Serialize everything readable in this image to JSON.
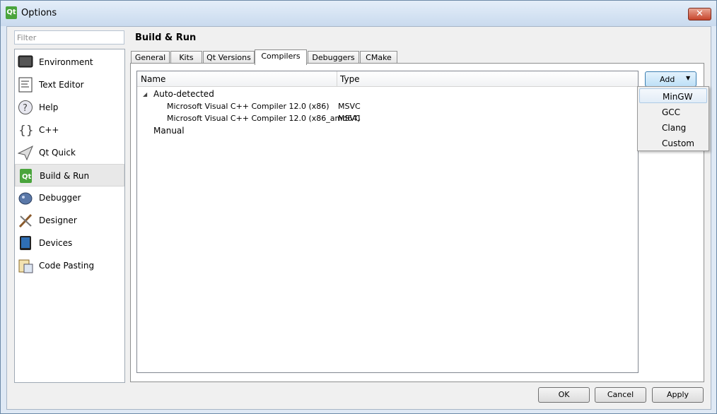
{
  "window": {
    "title": "Options",
    "app_icon": "qt-icon",
    "close_label": "✕"
  },
  "filter": {
    "placeholder": "Filter"
  },
  "sidebar": {
    "items": [
      {
        "label": "Environment",
        "icon": "monitor-icon"
      },
      {
        "label": "Text Editor",
        "icon": "text-editor-icon"
      },
      {
        "label": "Help",
        "icon": "help-icon"
      },
      {
        "label": "C++",
        "icon": "cpp-icon"
      },
      {
        "label": "Qt Quick",
        "icon": "qt-quick-icon"
      },
      {
        "label": "Build & Run",
        "icon": "build-run-icon",
        "selected": true
      },
      {
        "label": "Debugger",
        "icon": "debugger-icon"
      },
      {
        "label": "Designer",
        "icon": "designer-icon"
      },
      {
        "label": "Devices",
        "icon": "devices-icon"
      },
      {
        "label": "Code Pasting",
        "icon": "code-pasting-icon"
      }
    ]
  },
  "page": {
    "title": "Build & Run"
  },
  "tabs": [
    {
      "label": "General"
    },
    {
      "label": "Kits"
    },
    {
      "label": "Qt Versions"
    },
    {
      "label": "Compilers",
      "active": true
    },
    {
      "label": "Debuggers"
    },
    {
      "label": "CMake"
    }
  ],
  "compilers": {
    "columns": [
      "Name",
      "Type"
    ],
    "auto_detected_label": "Auto-detected",
    "rows": [
      {
        "name": "Microsoft Visual C++ Compiler 12.0 (x86)",
        "type": "MSVC"
      },
      {
        "name": "Microsoft Visual C++ Compiler 12.0 (x86_amd64)",
        "type": "MSVC"
      }
    ],
    "manual_label": "Manual"
  },
  "add_button": {
    "label": "Add"
  },
  "add_menu": {
    "items": [
      "MinGW",
      "GCC",
      "Clang",
      "Custom"
    ],
    "hovered": "MinGW"
  },
  "footer": {
    "ok": "OK",
    "cancel": "Cancel",
    "apply": "Apply"
  }
}
